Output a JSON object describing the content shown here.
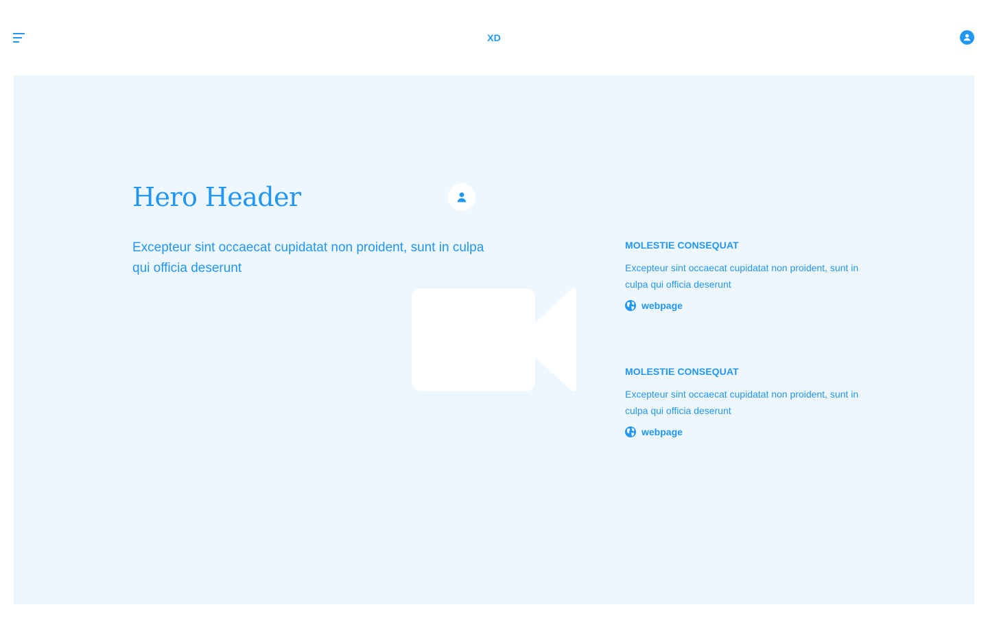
{
  "header": {
    "menu_icon": "menu-icon",
    "brand": "XD",
    "account_icon": "account-icon"
  },
  "hero": {
    "title": "Hero Header",
    "avatar_icon": "person-icon",
    "text": "Excepteur sint occaecat cupidatat non proident, sunt in culpa qui officia deserunt",
    "media_icon": "video-camera-icon"
  },
  "features": [
    {
      "title": "MOLESTIE CONSEQUAT",
      "text": "Excepteur sint occaecat cupidatat non proident, sunt in culpa qui officia deserunt",
      "link_icon": "globe-icon",
      "link_label": "webpage"
    },
    {
      "title": "MOLESTIE CONSEQUAT",
      "text": "Excepteur sint occaecat cupidatat non proident, sunt in culpa qui officia deserunt",
      "link_icon": "globe-icon",
      "link_label": "webpage"
    }
  ],
  "colors": {
    "accent": "#2196f3",
    "hero_background": "#eff7fe",
    "page_background": "#ffffff",
    "placeholder": "#ffffff"
  }
}
